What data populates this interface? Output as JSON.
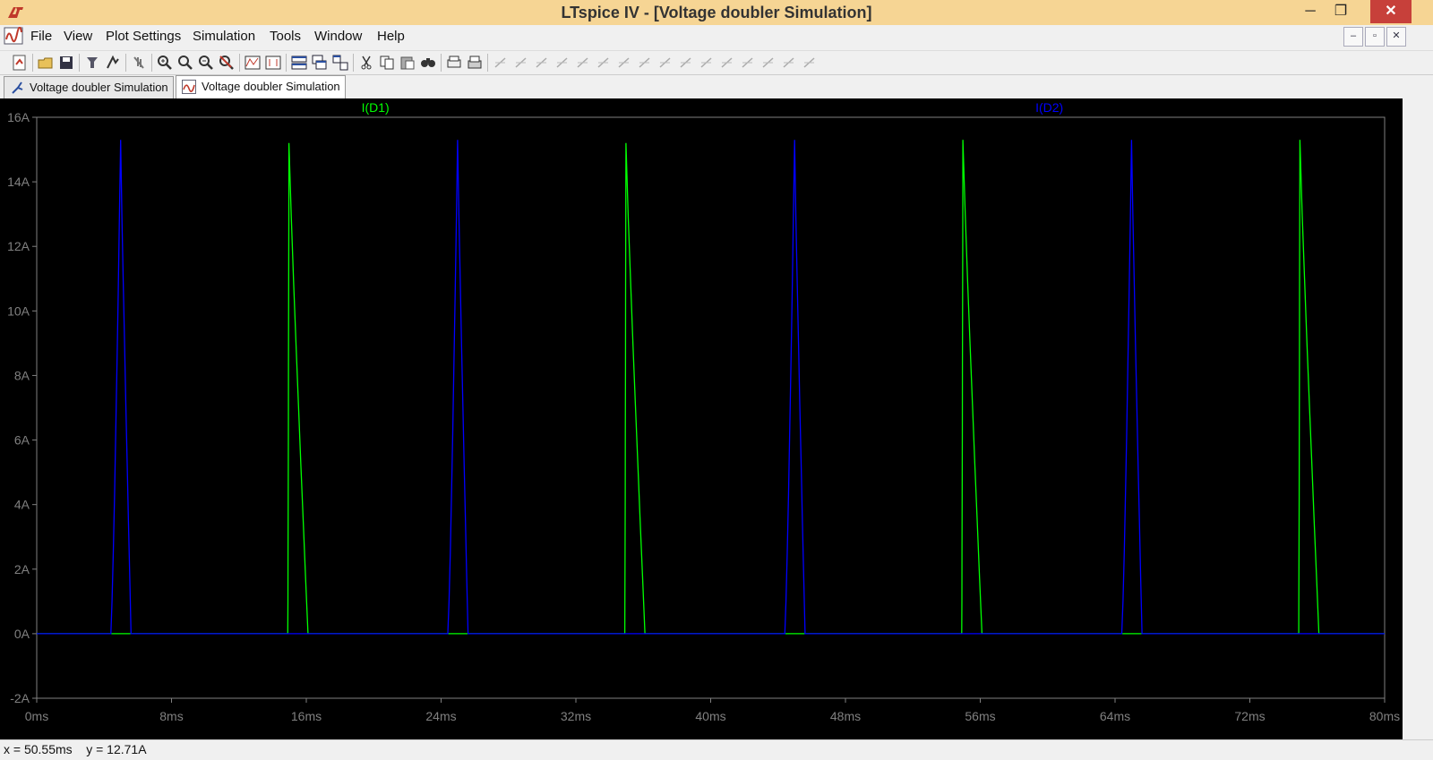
{
  "window": {
    "title": "LTspice IV - [Voltage doubler Simulation]",
    "minimize": "─",
    "maximize": "❐",
    "close": "✕"
  },
  "menu": {
    "items": [
      "File",
      "View",
      "Plot Settings",
      "Simulation",
      "Tools",
      "Window",
      "Help"
    ]
  },
  "mdi": {
    "minimize": "–",
    "restore": "▫",
    "close": "✕"
  },
  "toolbar": {
    "icons": [
      "new-schematic-icon",
      "open-icon",
      "save-icon",
      "control-panel-icon",
      "run-icon",
      "halt-icon",
      "zoom-in-icon",
      "zoom-area-icon",
      "zoom-out-icon",
      "zoom-fit-icon",
      "autorange-icon",
      "manual-limits-icon",
      "tile-horizontal-icon",
      "cascade-icon",
      "tile-icon",
      "cut-icon",
      "copy-icon",
      "paste-icon",
      "find-icon",
      "print-preview-icon",
      "print-icon",
      "wire-icon",
      "ground-icon",
      "label-icon",
      "resistor-icon",
      "capacitor-icon",
      "inductor-icon",
      "diode-icon",
      "component-icon",
      "move-icon",
      "drag-icon",
      "undo-icon",
      "redo-icon",
      "rotate-icon",
      "mirror-icon",
      "text-icon",
      "spice-directive-icon"
    ]
  },
  "tabs": [
    {
      "label": "Voltage doubler Simulation",
      "icon": "schematic-icon",
      "active": false
    },
    {
      "label": "Voltage doubler Simulation",
      "icon": "waveform-icon",
      "active": true
    }
  ],
  "status": {
    "text": "x = 50.55ms    y = 12.71A"
  },
  "colors": {
    "plot_bg": "#000000",
    "grid": "#808080",
    "d1": "#00ff00",
    "d2": "#0000ff"
  },
  "chart_data": {
    "type": "line",
    "title": "",
    "xlabel": "",
    "ylabel": "",
    "xlim": [
      0,
      80
    ],
    "ylim": [
      -2,
      16
    ],
    "x_unit": "ms",
    "y_unit": "A",
    "x_ticks": [
      "0ms",
      "8ms",
      "16ms",
      "24ms",
      "32ms",
      "40ms",
      "48ms",
      "56ms",
      "64ms",
      "72ms",
      "80ms"
    ],
    "y_ticks": [
      "-2A",
      "0A",
      "2A",
      "4A",
      "6A",
      "8A",
      "10A",
      "12A",
      "14A",
      "16A"
    ],
    "grid": "box-only",
    "legend_placement": "top",
    "series": [
      {
        "name": "I(D1)",
        "color": "#00ff00",
        "pulses": [
          {
            "start": 14.9,
            "peak_time": 14.97,
            "peak": 15.2,
            "end": 16.1
          },
          {
            "start": 34.9,
            "peak_time": 34.97,
            "peak": 15.2,
            "end": 36.1
          },
          {
            "start": 54.9,
            "peak_time": 54.97,
            "peak": 15.3,
            "end": 56.1
          },
          {
            "start": 74.9,
            "peak_time": 74.97,
            "peak": 15.3,
            "end": 76.1
          }
        ]
      },
      {
        "name": "I(D2)",
        "color": "#0000ff",
        "pulses": [
          {
            "start": 4.4,
            "peak_time": 4.98,
            "peak": 15.3,
            "end": 5.6
          },
          {
            "start": 24.4,
            "peak_time": 24.98,
            "peak": 15.3,
            "end": 25.6
          },
          {
            "start": 44.4,
            "peak_time": 44.98,
            "peak": 15.3,
            "end": 45.6
          },
          {
            "start": 64.4,
            "peak_time": 64.98,
            "peak": 15.3,
            "end": 65.6
          }
        ]
      }
    ]
  }
}
